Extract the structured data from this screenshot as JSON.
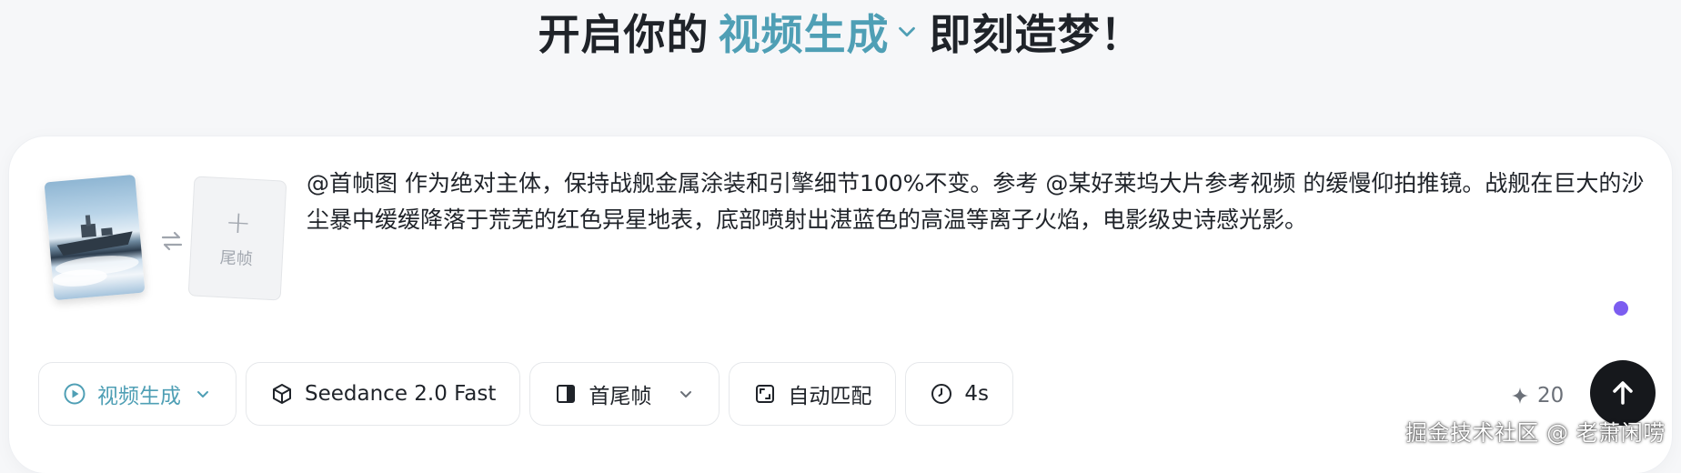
{
  "headline": {
    "prefix": "开启你的",
    "mode": "视频生成",
    "suffix": "即刻造梦！"
  },
  "frames": {
    "first_alt": "首帧图",
    "last_label": "尾帧",
    "last_add": "+"
  },
  "prompt": {
    "text": "@首帧图 作为绝对主体，保持战舰金属涂装和引擎细节100%不变。参考 @某好莱坞大片参考视频 的缓慢仰拍推镜。战舰在巨大的沙尘暴中缓缓降落于荒芜的红色异星地表，底部喷射出湛蓝色的高温等离子火焰，电影级史诗感光影。"
  },
  "toolbar": {
    "mode": "视频生成",
    "model": "Seedance 2.0 Fast",
    "frame_mode": "首尾帧",
    "ratio": "自动匹配",
    "duration": "4s"
  },
  "credits": {
    "value": "20"
  },
  "watermark": "掘金技术社区 @ 老萧闲唠",
  "colors": {
    "accent": "#4f9fb5",
    "send": "#16181c",
    "cursor": "#7c5df0"
  }
}
